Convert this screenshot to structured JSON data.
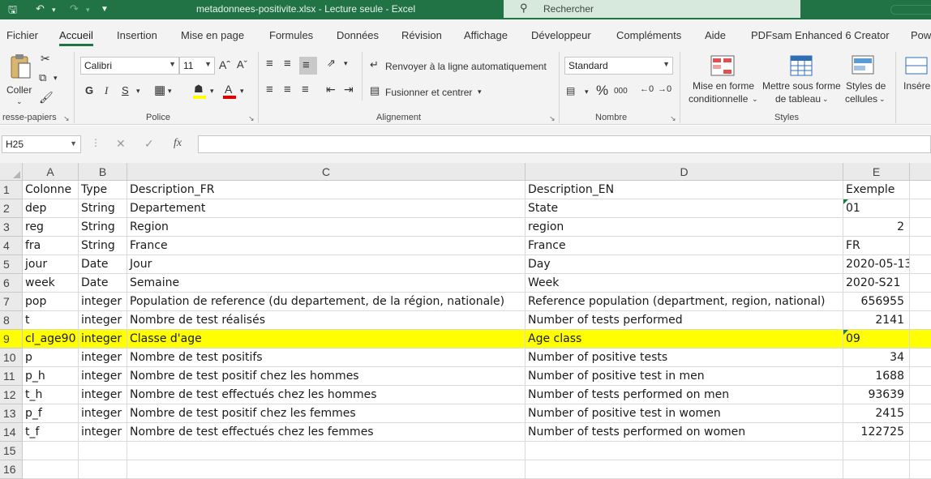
{
  "titlebar": {
    "document_title": "metadonnees-positivite.xlsx  -  Lecture seule  -  Excel",
    "search_placeholder": "Rechercher"
  },
  "ribbon_tabs": [
    "Fichier",
    "Accueil",
    "Insertion",
    "Mise en page",
    "Formules",
    "Données",
    "Révision",
    "Affichage",
    "Développeur",
    "Compléments",
    "Aide",
    "PDFsam Enhanced 6 Creator",
    "Pow"
  ],
  "active_tab": "Accueil",
  "ribbon": {
    "clipboard": {
      "paste_label": "Coller",
      "group_label": "resse-papiers"
    },
    "font": {
      "name": "Calibri",
      "size": "11",
      "bold": "G",
      "italic": "I",
      "underline": "S",
      "group_label": "Police"
    },
    "alignment": {
      "wrap_text": "Renvoyer à la ligne automatiquement",
      "merge_center": "Fusionner et centrer",
      "group_label": "Alignement"
    },
    "number": {
      "format": "Standard",
      "percent": "%",
      "thousands": "000",
      "group_label": "Nombre"
    },
    "styles": {
      "conditional_1": "Mise en forme",
      "conditional_2": "conditionnelle",
      "table_1": "Mettre sous forme",
      "table_2": "de tableau",
      "cell_1": "Styles de",
      "cell_2": "cellules",
      "group_label": "Styles"
    },
    "cells": {
      "insert": "Insére"
    }
  },
  "formula_bar": {
    "name_box": "H25",
    "formula": ""
  },
  "grid": {
    "columns": [
      "A",
      "B",
      "C",
      "D",
      "E"
    ],
    "selected_row": 9,
    "rows": [
      {
        "n": "1",
        "cells": [
          "Colonne",
          "Type",
          "Description_FR",
          "Description_EN",
          "Exemple"
        ]
      },
      {
        "n": "2",
        "cells": [
          "dep",
          "String",
          "Departement",
          "State",
          "01"
        ]
      },
      {
        "n": "3",
        "cells": [
          "reg",
          "String",
          "Region",
          "region",
          "2"
        ]
      },
      {
        "n": "4",
        "cells": [
          "fra",
          "String",
          "France",
          "France",
          "FR"
        ]
      },
      {
        "n": "5",
        "cells": [
          "jour",
          "Date",
          "Jour",
          "Day",
          "2020-05-13"
        ]
      },
      {
        "n": "6",
        "cells": [
          "week",
          "Date",
          "Semaine",
          "Week",
          "2020-S21"
        ]
      },
      {
        "n": "7",
        "cells": [
          "pop",
          "integer",
          "Population de reference (du departement, de la région, nationale)",
          "Reference population (department, region, national)",
          "656955"
        ]
      },
      {
        "n": "8",
        "cells": [
          "t",
          "integer",
          "Nombre de test réalisés",
          "Number of tests performed",
          "2141"
        ]
      },
      {
        "n": "9",
        "cells": [
          "cl_age90",
          "integer",
          "Classe d'age",
          "Age class",
          "09"
        ]
      },
      {
        "n": "10",
        "cells": [
          "p",
          "integer",
          "Nombre de test positifs",
          "Number of positive tests",
          "34"
        ]
      },
      {
        "n": "11",
        "cells": [
          "p_h",
          "integer",
          "Nombre de test positif chez les hommes",
          "Number of positive test in men",
          "1688"
        ]
      },
      {
        "n": "12",
        "cells": [
          "t_h",
          "integer",
          "Nombre de test effectués chez les hommes",
          "Number of tests performed on men",
          "93639"
        ]
      },
      {
        "n": "13",
        "cells": [
          "p_f",
          "integer",
          "Nombre de test positif chez les femmes",
          "Number of positive test in women",
          "2415"
        ]
      },
      {
        "n": "14",
        "cells": [
          "t_f",
          "integer",
          "Nombre de test effectués chez les femmes",
          "Number of tests performed on women",
          "122725"
        ]
      },
      {
        "n": "15",
        "cells": [
          "",
          "",
          "",
          "",
          ""
        ]
      },
      {
        "n": "16",
        "cells": [
          "",
          "",
          "",
          "",
          ""
        ]
      }
    ],
    "number_cells": [
      "2",
      "656955",
      "2141",
      "34",
      "1688",
      "93639",
      "2415",
      "122725"
    ],
    "text_number_cells": [
      "01",
      "09"
    ]
  },
  "colors": {
    "excel_green": "#217346",
    "highlight": "#ffff00"
  }
}
